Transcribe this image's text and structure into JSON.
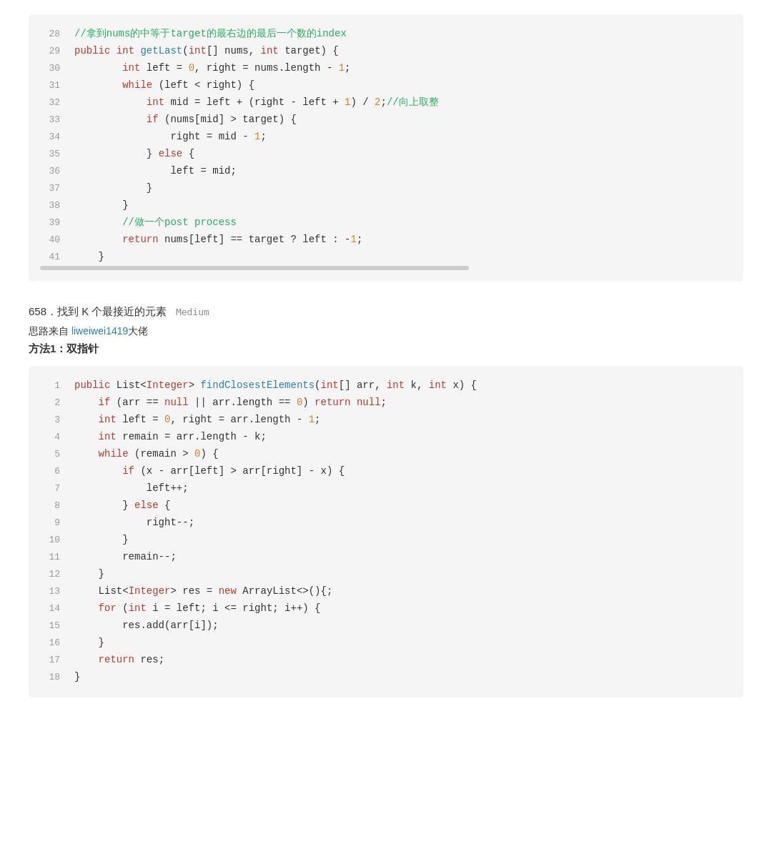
{
  "block1": {
    "lines": [
      {
        "num": 28,
        "tokens": [
          {
            "t": "cm",
            "v": "//拿到nums的中等于target的最右边的最后一个数的index"
          }
        ]
      },
      {
        "num": 29,
        "tokens": [
          {
            "t": "kw",
            "v": "public"
          },
          {
            "t": "",
            "v": " "
          },
          {
            "t": "kw",
            "v": "int"
          },
          {
            "t": "",
            "v": " "
          },
          {
            "t": "fn",
            "v": "getLast"
          },
          {
            "t": "",
            "v": "("
          },
          {
            "t": "kw",
            "v": "int"
          },
          {
            "t": "",
            "v": "[] nums, "
          },
          {
            "t": "kw",
            "v": "int"
          },
          {
            "t": "",
            "v": " target) {"
          }
        ]
      },
      {
        "num": 30,
        "tokens": [
          {
            "t": "",
            "v": "        "
          },
          {
            "t": "kw",
            "v": "int"
          },
          {
            "t": "",
            "v": " left = "
          },
          {
            "t": "num",
            "v": "0"
          },
          {
            "t": "",
            "v": ", right = nums.length - "
          },
          {
            "t": "num",
            "v": "1"
          },
          {
            "t": "",
            "v": ";"
          }
        ]
      },
      {
        "num": 31,
        "tokens": [
          {
            "t": "",
            "v": "        "
          },
          {
            "t": "kw",
            "v": "while"
          },
          {
            "t": "",
            "v": " (left < right) {"
          }
        ]
      },
      {
        "num": 32,
        "tokens": [
          {
            "t": "",
            "v": "            "
          },
          {
            "t": "kw",
            "v": "int"
          },
          {
            "t": "",
            "v": " mid = left + (right - left + "
          },
          {
            "t": "num",
            "v": "1"
          },
          {
            "t": "",
            "v": ") / "
          },
          {
            "t": "num",
            "v": "2"
          },
          {
            "t": "",
            "v": ";"
          },
          {
            "t": "cm",
            "v": "//向上取整"
          }
        ]
      },
      {
        "num": 33,
        "tokens": [
          {
            "t": "",
            "v": "            "
          },
          {
            "t": "kw",
            "v": "if"
          },
          {
            "t": "",
            "v": " (nums[mid] > target) {"
          }
        ]
      },
      {
        "num": 34,
        "tokens": [
          {
            "t": "",
            "v": "                right = mid - "
          },
          {
            "t": "num",
            "v": "1"
          },
          {
            "t": "",
            "v": ";"
          }
        ]
      },
      {
        "num": 35,
        "tokens": [
          {
            "t": "",
            "v": "            } "
          },
          {
            "t": "kw",
            "v": "else"
          },
          {
            "t": "",
            "v": " {"
          }
        ]
      },
      {
        "num": 36,
        "tokens": [
          {
            "t": "",
            "v": "                left = mid;"
          }
        ]
      },
      {
        "num": 37,
        "tokens": [
          {
            "t": "",
            "v": "            }"
          }
        ]
      },
      {
        "num": 38,
        "tokens": [
          {
            "t": "",
            "v": "        }"
          }
        ]
      },
      {
        "num": 39,
        "tokens": [
          {
            "t": "",
            "v": "        "
          },
          {
            "t": "cm",
            "v": "//做一个post process"
          }
        ]
      },
      {
        "num": 40,
        "tokens": [
          {
            "t": "",
            "v": "        "
          },
          {
            "t": "kw",
            "v": "return"
          },
          {
            "t": "",
            "v": " nums[left] == target ? left : -"
          },
          {
            "t": "num",
            "v": "1"
          },
          {
            "t": "",
            "v": ";"
          }
        ]
      },
      {
        "num": 41,
        "tokens": [
          {
            "t": "",
            "v": "    }"
          }
        ]
      }
    ]
  },
  "section2": {
    "problem": "658．找到 K 个最接近的元素",
    "difficulty": "Medium",
    "source_label": "思路来自 ",
    "source_link_text": "liweiwei1419",
    "source_suffix": "大佬",
    "method_label": "方法1：双指针"
  },
  "block2": {
    "lines": [
      {
        "num": 1,
        "tokens": [
          {
            "t": "kw",
            "v": "public"
          },
          {
            "t": "",
            "v": " List<"
          },
          {
            "t": "kw",
            "v": "Integer"
          },
          {
            "t": "",
            "v": "> "
          },
          {
            "t": "fn",
            "v": "findClosestElements"
          },
          {
            "t": "",
            "v": "("
          },
          {
            "t": "kw",
            "v": "int"
          },
          {
            "t": "",
            "v": "[] arr, "
          },
          {
            "t": "kw",
            "v": "int"
          },
          {
            "t": "",
            "v": " k, "
          },
          {
            "t": "kw",
            "v": "int"
          },
          {
            "t": "",
            "v": " x) {"
          }
        ]
      },
      {
        "num": 2,
        "tokens": [
          {
            "t": "",
            "v": "    "
          },
          {
            "t": "kw",
            "v": "if"
          },
          {
            "t": "",
            "v": " (arr == "
          },
          {
            "t": "kw",
            "v": "null"
          },
          {
            "t": "",
            "v": " || arr.length == "
          },
          {
            "t": "num",
            "v": "0"
          },
          {
            "t": "",
            "v": ") "
          },
          {
            "t": "kw",
            "v": "return"
          },
          {
            "t": "",
            "v": " "
          },
          {
            "t": "kw",
            "v": "null"
          },
          {
            "t": "",
            "v": ";"
          }
        ]
      },
      {
        "num": 3,
        "tokens": [
          {
            "t": "",
            "v": "    "
          },
          {
            "t": "kw",
            "v": "int"
          },
          {
            "t": "",
            "v": " left = "
          },
          {
            "t": "num",
            "v": "0"
          },
          {
            "t": "",
            "v": ", right = arr.length - "
          },
          {
            "t": "num",
            "v": "1"
          },
          {
            "t": "",
            "v": ";"
          }
        ]
      },
      {
        "num": 4,
        "tokens": [
          {
            "t": "",
            "v": "    "
          },
          {
            "t": "kw",
            "v": "int"
          },
          {
            "t": "",
            "v": " remain = arr.length - k;"
          }
        ]
      },
      {
        "num": 5,
        "tokens": [
          {
            "t": "",
            "v": "    "
          },
          {
            "t": "kw",
            "v": "while"
          },
          {
            "t": "",
            "v": " (remain > "
          },
          {
            "t": "num",
            "v": "0"
          },
          {
            "t": "",
            "v": ") {"
          }
        ]
      },
      {
        "num": 6,
        "tokens": [
          {
            "t": "",
            "v": "        "
          },
          {
            "t": "kw",
            "v": "if"
          },
          {
            "t": "",
            "v": " (x - arr[left] > arr[right] - x) {"
          }
        ]
      },
      {
        "num": 7,
        "tokens": [
          {
            "t": "",
            "v": "            left++;"
          }
        ]
      },
      {
        "num": 8,
        "tokens": [
          {
            "t": "",
            "v": "        } "
          },
          {
            "t": "kw",
            "v": "else"
          },
          {
            "t": "",
            "v": " {"
          }
        ]
      },
      {
        "num": 9,
        "tokens": [
          {
            "t": "",
            "v": "            right--;"
          }
        ]
      },
      {
        "num": 10,
        "tokens": [
          {
            "t": "",
            "v": "        }"
          }
        ]
      },
      {
        "num": 11,
        "tokens": [
          {
            "t": "",
            "v": "        remain--;"
          }
        ]
      },
      {
        "num": 12,
        "tokens": [
          {
            "t": "",
            "v": "    }"
          }
        ]
      },
      {
        "num": 13,
        "tokens": [
          {
            "t": "",
            "v": "    List<"
          },
          {
            "t": "kw",
            "v": "Integer"
          },
          {
            "t": "",
            "v": "> res = "
          },
          {
            "t": "kw",
            "v": "new"
          },
          {
            "t": "",
            "v": " ArrayList<>(){;"
          }
        ]
      },
      {
        "num": 14,
        "tokens": [
          {
            "t": "",
            "v": "    "
          },
          {
            "t": "kw",
            "v": "for"
          },
          {
            "t": "",
            "v": " ("
          },
          {
            "t": "kw",
            "v": "int"
          },
          {
            "t": "",
            "v": " i = left; i <= right; i++) {"
          }
        ]
      },
      {
        "num": 15,
        "tokens": [
          {
            "t": "",
            "v": "        res.add(arr[i]);"
          }
        ]
      },
      {
        "num": 16,
        "tokens": [
          {
            "t": "",
            "v": "    }"
          }
        ]
      },
      {
        "num": 17,
        "tokens": [
          {
            "t": "",
            "v": "    "
          },
          {
            "t": "kw",
            "v": "return"
          },
          {
            "t": "",
            "v": " res;"
          }
        ]
      },
      {
        "num": 18,
        "tokens": [
          {
            "t": "",
            "v": "}"
          }
        ]
      }
    ]
  }
}
